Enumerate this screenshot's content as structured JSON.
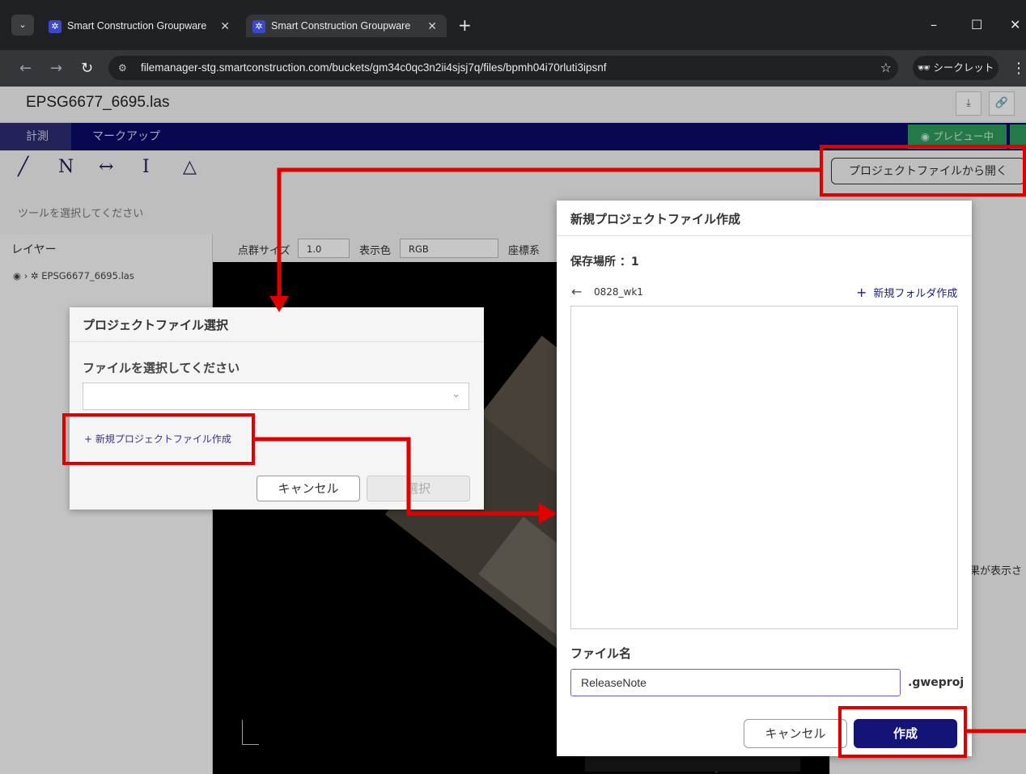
{
  "browser": {
    "tabs": [
      {
        "title": "Smart Construction Groupware",
        "close": "✕"
      },
      {
        "title": "Smart Construction Groupware",
        "close": "✕"
      }
    ],
    "new_tab": "+",
    "url": "filemanager-stg.smartconstruction.com/buckets/gm34c0qc3n2ii4sjsj7q/files/bpmh04i70rluti3ipsnf",
    "incognito_label": "シークレット"
  },
  "app": {
    "file_title": "EPSG6677_6695.las",
    "mode_tabs": [
      "計測",
      "マークアップ"
    ],
    "preview_label": "プレビュー中",
    "open_project_label": "プロジェクトファイルから開く",
    "tool_hint": "ツールを選択してください",
    "layer_heading": "レイヤー",
    "layer_item": "EPSG6677_6695.las",
    "settings": {
      "point_size_label": "点群サイズ",
      "point_size_value": "1.0",
      "color_label": "表示色",
      "color_value": "RGB",
      "coord_label": "座標系"
    },
    "right_panel_text": "果が表示さ"
  },
  "select_dialog": {
    "title": "プロジェクトファイル選択",
    "label": "ファイルを選択してください",
    "new_link": "+ 新規プロジェクトファイル作成",
    "cancel": "キャンセル",
    "choose": "選択"
  },
  "create_dialog": {
    "title": "新規プロジェクトファイル作成",
    "save_location": "保存場所 ：1",
    "folder": "0828_wk1",
    "new_folder": "新規フォルダ作成",
    "file_name_label": "ファイル名",
    "file_name_value": "ReleaseNote",
    "extension": ".gweproj",
    "cancel": "キャンセル",
    "create": "作成"
  },
  "colors": {
    "annotation_red": "#e00000",
    "nav_bar": "#0a0a67",
    "primary_button": "#131378"
  }
}
